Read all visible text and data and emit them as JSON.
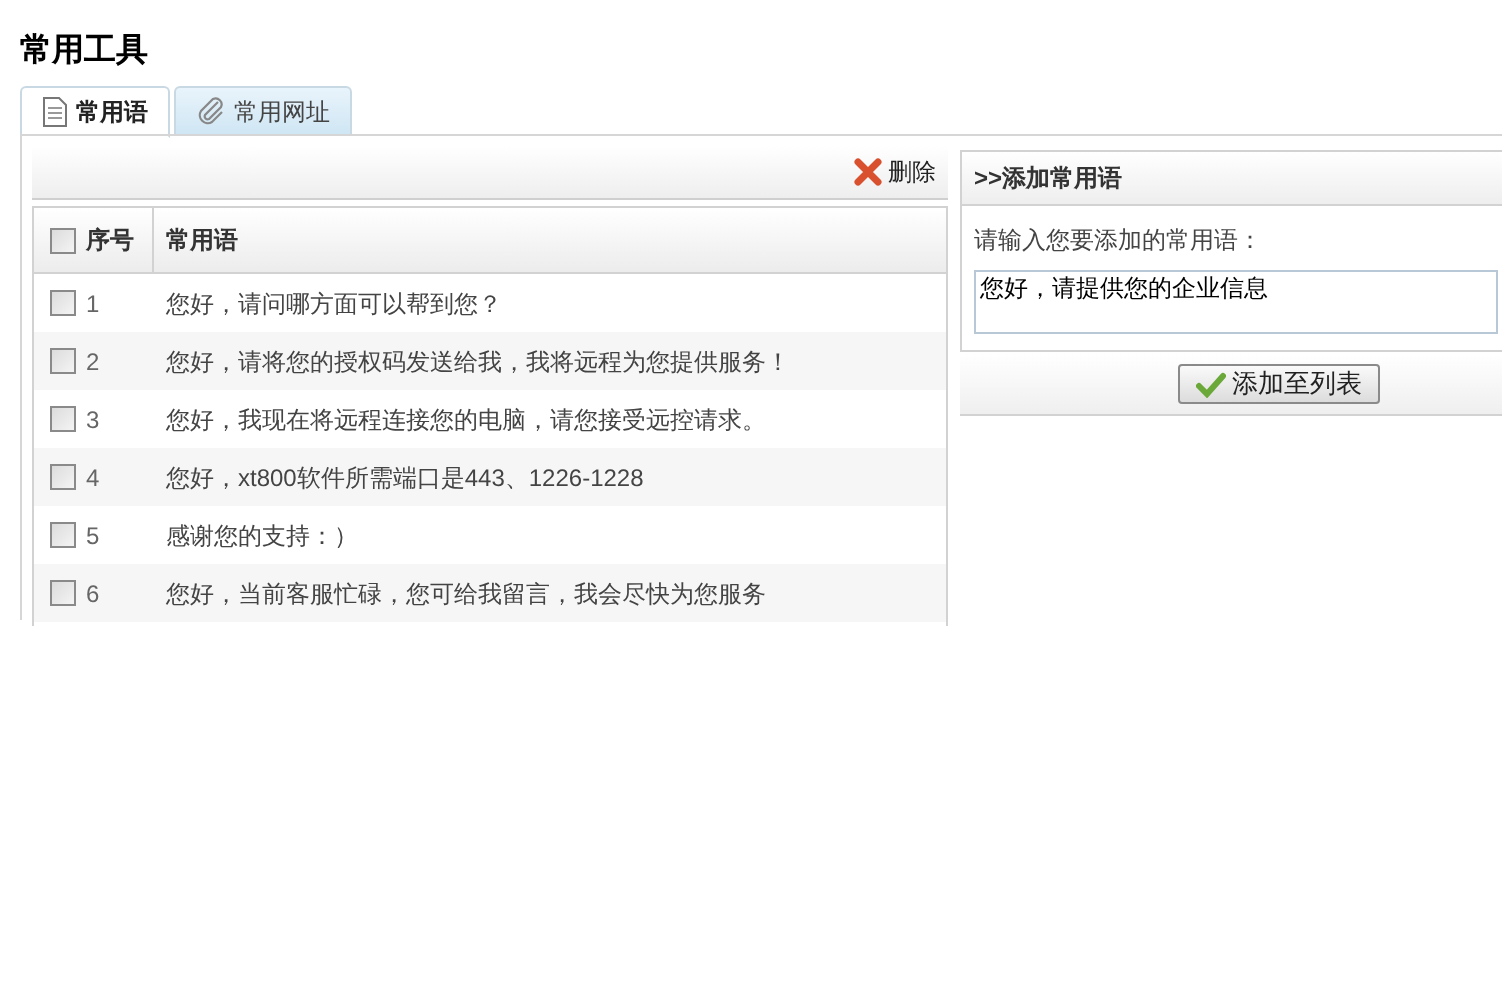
{
  "title": "常用工具",
  "tabs": [
    {
      "label": "常用语",
      "selected": true,
      "kind": "document"
    },
    {
      "label": "常用网址",
      "selected": false,
      "kind": "link"
    }
  ],
  "toolbar": {
    "delete_label": "删除"
  },
  "table": {
    "select_all_checked": false,
    "columns": [
      "序号",
      "常用语"
    ],
    "rows": [
      {
        "index": "1",
        "text": "您好，请问哪方面可以帮到您？",
        "checked": false
      },
      {
        "index": "2",
        "text": "您好，请将您的授权码发送给我，我将远程为您提供服务！",
        "checked": false
      },
      {
        "index": "3",
        "text": "您好，我现在将远程连接您的电脑，请您接受远控请求。",
        "checked": false
      },
      {
        "index": "4",
        "text": "您好，xt800软件所需端口是443、1226-1228",
        "checked": false
      },
      {
        "index": "5",
        "text": "感谢您的支持：）",
        "checked": false
      },
      {
        "index": "6",
        "text": "您好，当前客服忙碌，您可给我留言，我会尽快为您服务",
        "checked": false
      }
    ]
  },
  "add_panel": {
    "title": ">>添加常用语",
    "label": "请输入您要添加的常用语：",
    "value": "您好，请提供您的企业信息",
    "button": "添加至列表"
  }
}
